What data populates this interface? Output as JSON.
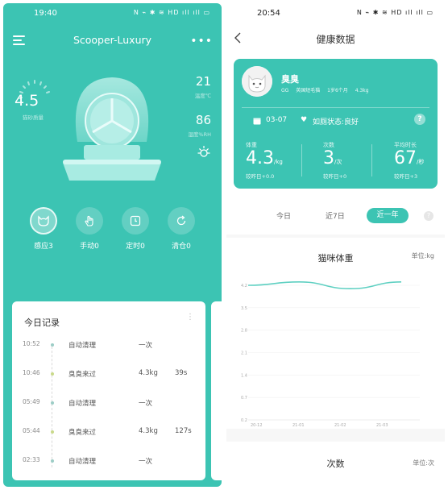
{
  "left": {
    "status": {
      "time": "19:40",
      "icons": "N ⌁ ✱ ≋ HD ıll ıll ▭"
    },
    "app_title": "Scooper-Luxury",
    "gauge": {
      "value": "4.5",
      "label": "猫砂质量"
    },
    "temperature": {
      "value": "21",
      "label": "温度℃"
    },
    "humidity": {
      "value": "86",
      "label": "湿度%RH"
    },
    "modes": [
      {
        "label": "感应3",
        "icon": "cat-face-icon",
        "active": true
      },
      {
        "label": "手动0",
        "icon": "hand-icon",
        "active": false
      },
      {
        "label": "定时0",
        "icon": "clock-icon",
        "active": false
      },
      {
        "label": "清仓0",
        "icon": "refresh-icon",
        "active": false
      }
    ],
    "today": {
      "title": "今日记录",
      "records": [
        {
          "time": "10:52",
          "action": "自动清理",
          "weight": "一次",
          "duration": ""
        },
        {
          "time": "10:46",
          "action": "臭臭来过",
          "weight": "4.3kg",
          "duration": "39s"
        },
        {
          "time": "05:49",
          "action": "自动清理",
          "weight": "一次",
          "duration": ""
        },
        {
          "time": "05:44",
          "action": "臭臭来过",
          "weight": "4.3kg",
          "duration": "127s"
        },
        {
          "time": "02:33",
          "action": "自动清理",
          "weight": "一次",
          "duration": ""
        }
      ]
    }
  },
  "right": {
    "status": {
      "time": "20:54",
      "icons": "N ⌁ ✱ ≋ HD ıll ıll ▭"
    },
    "title": "健康数据",
    "profile": {
      "name": "臭臭",
      "sex": "GG",
      "breed": "英国短毛猫",
      "age": "1岁6个月",
      "weight": "4.3kg",
      "date": "03-07",
      "status": "如厕状态:良好"
    },
    "stats": [
      {
        "head": "体重",
        "value": "4.3",
        "unit": "/kg",
        "compare": "较昨日+0.0"
      },
      {
        "head": "次数",
        "value": "3",
        "unit": "/次",
        "compare": "较昨日+0"
      },
      {
        "head": "平均时长",
        "value": "67",
        "unit": "/秒",
        "compare": "较昨日+3"
      }
    ],
    "tabs": [
      "今日",
      "近7日",
      "近一年"
    ],
    "active_tab": "近一年",
    "weight_chart_title": "猫咪体重",
    "weight_chart_unit": "单位:kg",
    "count_title": "次数",
    "count_unit": "单位:次"
  },
  "chart_data": {
    "type": "line",
    "title": "猫咪体重",
    "xlabel": "",
    "ylabel": "单位:kg",
    "ylim": [
      0.2,
      4.2
    ],
    "y_ticks": [
      "4.2",
      "3.5",
      "2.8",
      "2.1",
      "1.4",
      "0.7",
      "0.2"
    ],
    "x_ticks": [
      "20-12",
      "21-01",
      "21-02",
      "21-03"
    ],
    "series": [
      {
        "name": "",
        "x": [
          "20-12",
          "21-01",
          "21-02",
          "21-03"
        ],
        "values": [
          4.2,
          4.3,
          4.1,
          4.3
        ]
      }
    ],
    "grid": true,
    "color": "#5fd0c2"
  },
  "colors": {
    "brand": "#3cc4b3"
  }
}
